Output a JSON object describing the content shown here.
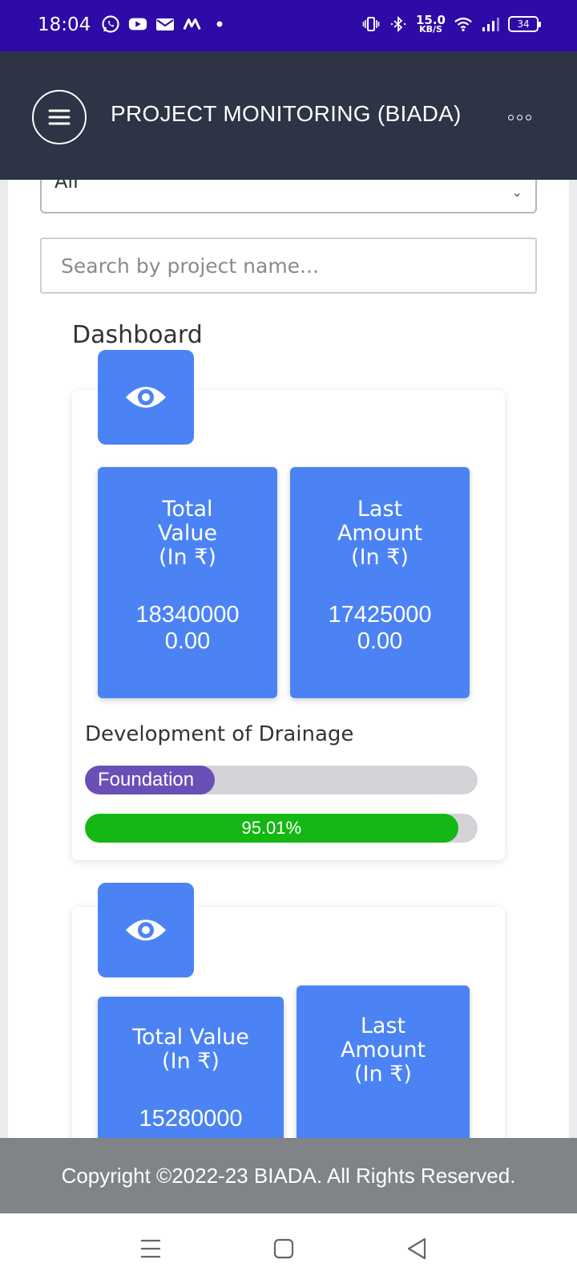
{
  "status_bar": {
    "time": "18:04",
    "net_speed": "15.0",
    "net_unit": "KB/S",
    "battery": "34",
    "icons_left": [
      "whatsapp-icon",
      "youtube-icon",
      "mail-icon",
      "m-app-icon",
      "dot-icon"
    ],
    "icons_right": [
      "vibrate-icon",
      "bluetooth-icon",
      "wifi-icon",
      "signal-icon",
      "battery-icon"
    ]
  },
  "app_bar": {
    "title": "PROJECT MONITORING (BIADA)",
    "menu_icon": "hamburger-icon",
    "more_icon": "more-dots-icon"
  },
  "filter": {
    "selected": "All"
  },
  "search": {
    "placeholder": "Search by project name..."
  },
  "dashboard": {
    "title": "Dashboard",
    "cards": [
      {
        "total_value_label": [
          "Total",
          "Value",
          "(In ₹)"
        ],
        "total_value": [
          "18340000",
          "0.00"
        ],
        "last_amount_label": [
          "Last",
          "Amount",
          "(In ₹)"
        ],
        "last_amount": [
          "17425000",
          "0.00"
        ],
        "project_name": "Development of Drainage",
        "stage": "Foundation",
        "stage_fraction": 0.33,
        "progress_label": "95.01%",
        "progress": 95.01
      },
      {
        "total_value_label": [
          "Total Value",
          "(In ₹)"
        ],
        "total_value": [
          "15280000"
        ],
        "last_amount_label": [
          "Last",
          "Amount",
          "(In ₹)"
        ]
      }
    ]
  },
  "footer": {
    "text": "Copyright ©2022-23 BIADA. All Rights Reserved."
  },
  "nav_bar": {
    "icons": [
      "recents-icon",
      "home-icon",
      "back-icon"
    ]
  },
  "colors": {
    "status_bar": "#2f0aa6",
    "app_bar": "#2d3446",
    "accent_blue": "#4b83f4",
    "stage_purple": "#6a4fb7",
    "progress_green": "#14b714",
    "footer": "#808487"
  }
}
